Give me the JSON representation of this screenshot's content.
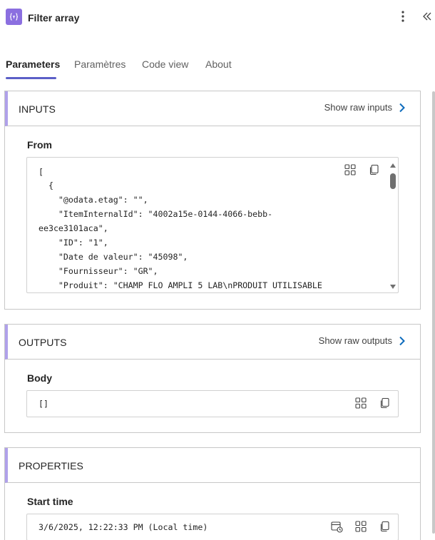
{
  "header": {
    "title": "Filter array",
    "icon": "filter-array-icon",
    "accent": "#8b6fe0"
  },
  "tabs": [
    {
      "label": "Parameters",
      "active": true
    },
    {
      "label": "Paramètres",
      "active": false
    },
    {
      "label": "Code view",
      "active": false
    },
    {
      "label": "About",
      "active": false
    }
  ],
  "inputs": {
    "title": "INPUTS",
    "show_raw": "Show raw inputs",
    "from_label": "From",
    "from_lines": [
      "[",
      "  {",
      "    \"@odata.etag\": \"\",",
      "    \"ItemInternalId\": \"4002a15e-0144-4066-bebb-",
      "ee3ce3101aca\",",
      "    \"ID\": \"1\",",
      "    \"Date de valeur\": \"45098\",",
      "    \"Fournisseur\": \"GR\",",
      "    \"Produit\": \"CHAMP FLO AMPLI 5 LAB\\nPRODUIT UTILISABLE"
    ]
  },
  "outputs": {
    "title": "OUTPUTS",
    "show_raw": "Show raw outputs",
    "body_label": "Body",
    "body_value": "[]"
  },
  "properties": {
    "title": "PROPERTIES",
    "start_label": "Start time",
    "start_value": "3/6/2025, 12:22:33 PM (Local time)"
  },
  "colors": {
    "section_accent": "#b0a1ea",
    "link_chevron": "#0f6cbd",
    "tab_underline": "#5b5fc7"
  }
}
